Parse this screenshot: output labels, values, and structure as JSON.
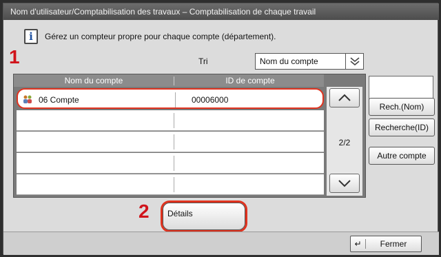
{
  "title": "Nom d'utilisateur/Comptabilisation des travaux – Comptabilisation de chaque travail",
  "info_text": "Gérez un compteur propre pour chaque compte (département).",
  "info_icon": "info-icon",
  "steps": {
    "step1": "1",
    "step2": "2"
  },
  "sort": {
    "label": "Tri",
    "selected": "Nom du compte"
  },
  "table": {
    "columns": [
      "Nom du compte",
      "ID de compte"
    ],
    "rows": [
      {
        "name": "06 Compte",
        "id": "00006000",
        "icon": "account-icon",
        "selected": true
      },
      {
        "name": "",
        "id": ""
      },
      {
        "name": "",
        "id": ""
      },
      {
        "name": "",
        "id": ""
      },
      {
        "name": "",
        "id": ""
      }
    ],
    "page": "2/2"
  },
  "side_buttons": {
    "search_name": "Rech.(Nom)",
    "search_id": "Recherche(ID)",
    "other_account": "Autre compte"
  },
  "details_label": "Détails",
  "close_label": "Fermer",
  "colors": {
    "highlight": "#e0321e",
    "title_bar": "#5a5a5a"
  }
}
